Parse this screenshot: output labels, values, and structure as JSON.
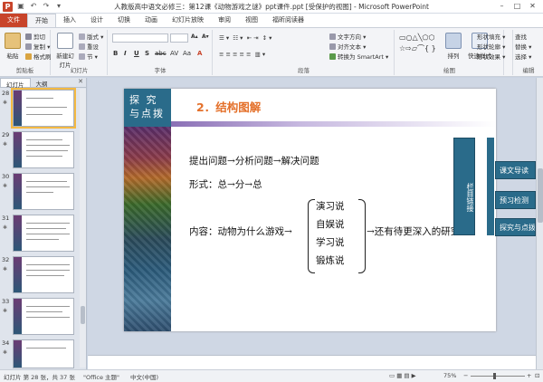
{
  "window": {
    "title": "人教版高中语文必修三：第12课《动物游戏之谜》ppt课件.ppt [受保护的视图] - Microsoft PowerPoint",
    "app_icon_letter": "P",
    "controls": [
      "–",
      "□",
      "✕"
    ]
  },
  "ribbon_tabs": [
    "文件",
    "开始",
    "插入",
    "设计",
    "切换",
    "动画",
    "幻灯片放映",
    "审阅",
    "视图",
    "福昕阅读器"
  ],
  "ribbon_groups": {
    "clipboard": {
      "label": "剪贴板",
      "paste": "粘贴",
      "cut": "剪切",
      "copy": "复制 ▾",
      "format_painter": "格式刷"
    },
    "slides": {
      "label": "幻灯片",
      "new_slide": "新建幻灯片",
      "layout": "版式 ▾",
      "reset": "重设",
      "section": "节 ▾"
    },
    "font": {
      "label": "字体",
      "bold": "B",
      "italic": "I",
      "underline": "U",
      "strike": "S",
      "abc": "abc",
      "spacing": "AV",
      "case": "Aa",
      "color": "A"
    },
    "paragraph": {
      "label": "段落",
      "text_direction": "文字方向 ▾",
      "align_text": "对齐文本 ▾",
      "smartart": "转换为 SmartArt ▾"
    },
    "drawing": {
      "label": "绘图",
      "arrange": "排列",
      "quick_styles": "快速样式",
      "fill": "形状填充 ▾",
      "outline": "形状轮廓 ▾",
      "effects": "形状效果 ▾"
    },
    "editing": {
      "label": "编辑",
      "find": "查找",
      "replace": "替换 ▾",
      "select": "选择 ▾"
    }
  },
  "left_pane": {
    "tabs": [
      "幻灯片",
      "大纲"
    ],
    "close": "✕",
    "thumbnails": [
      {
        "num": "28",
        "selected": true
      },
      {
        "num": "29",
        "selected": false
      },
      {
        "num": "30",
        "selected": false
      },
      {
        "num": "31",
        "selected": false
      },
      {
        "num": "32",
        "selected": false
      },
      {
        "num": "33",
        "selected": false
      },
      {
        "num": "34",
        "selected": false
      }
    ],
    "star": "✱"
  },
  "slide": {
    "tanjiu_line1": "探 究",
    "tanjiu_line2": "与点拨",
    "section_title": "2．结构图解",
    "line1": "提出问题→分析问题→解决问题",
    "line2": "形式：总→分→总",
    "line3_prefix": "内容：动物为什么游戏→",
    "theories": [
      "演习说",
      "自娱说",
      "学习说",
      "锻炼说"
    ],
    "line3_suffix": "→还有待更深入的研究",
    "vertical_tab": "栏目链接",
    "nav_buttons": [
      "课文导读",
      "预习检测",
      "探究与点拨"
    ]
  },
  "status_bar": {
    "slide_info": "幻灯片 第 28 张，共 37 张",
    "theme": "\"Office 主题\"",
    "language": "中文(中国)",
    "zoom": "75%",
    "zoom_level": 0.75
  },
  "colors": {
    "file_tab": "#c8442a",
    "title_orange": "#e4702a",
    "teal": "#2a6b8a",
    "selection": "#f4b942"
  }
}
